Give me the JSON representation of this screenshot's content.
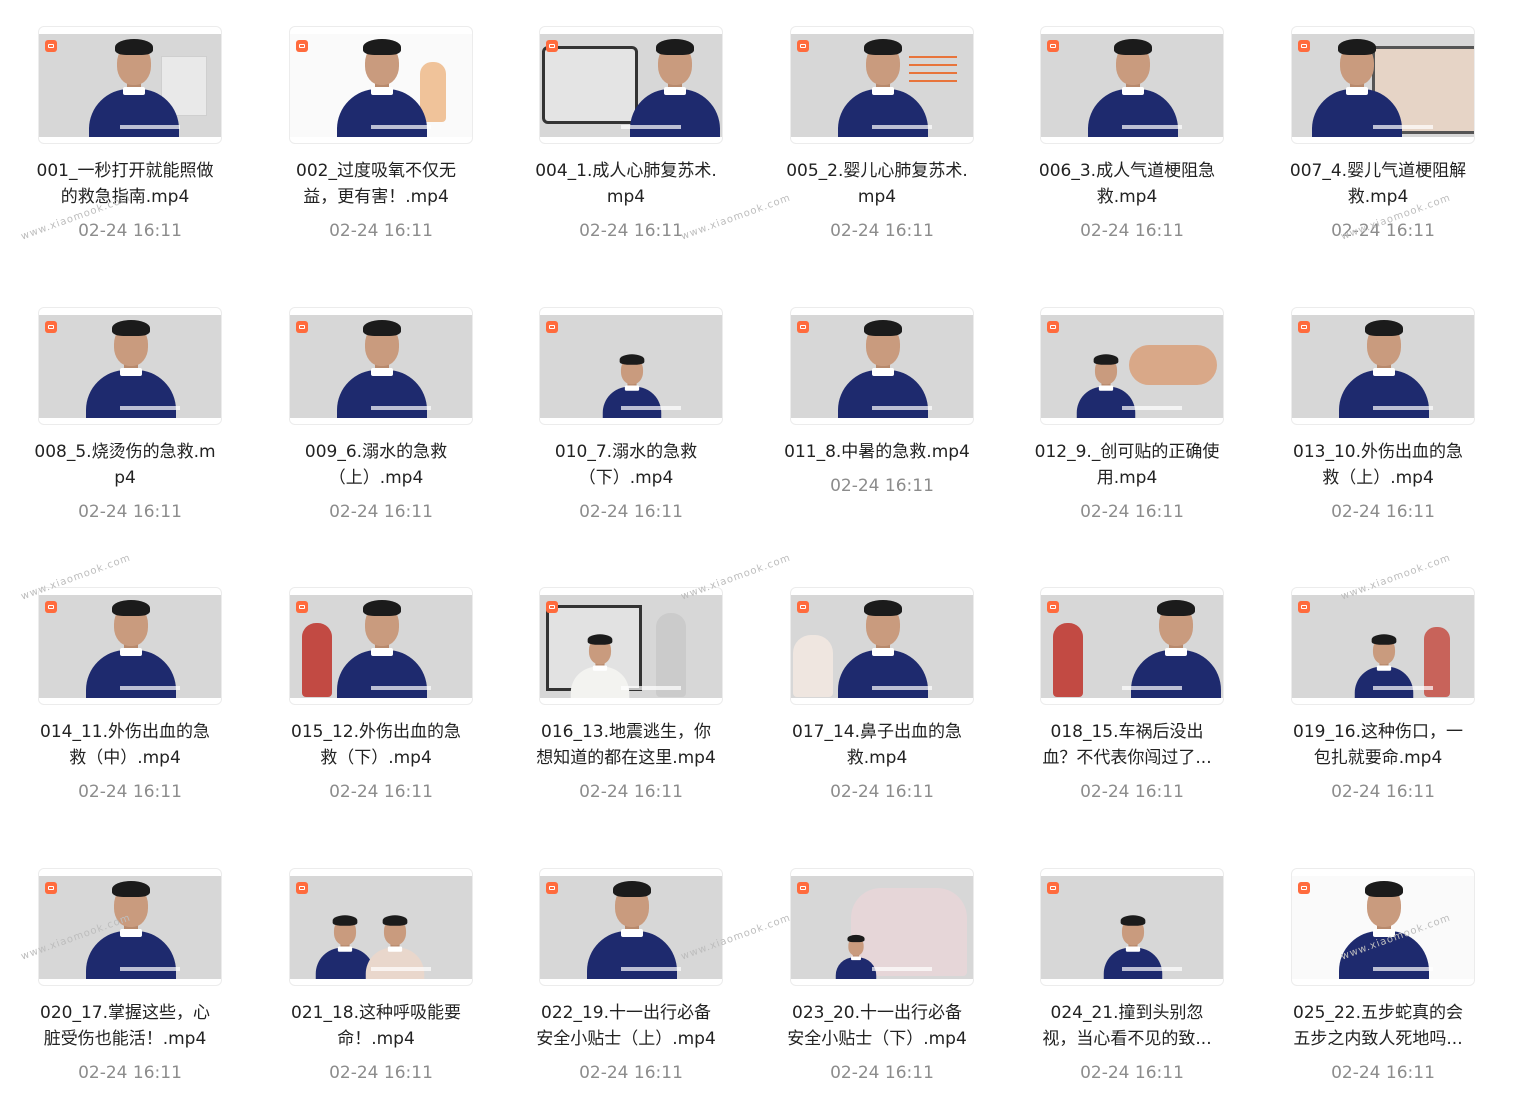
{
  "files": [
    {
      "title": "001_一秒打开就能照做\n的救急指南.mp4",
      "date": "02-24 16:11"
    },
    {
      "title": "002_过度吸氧不仅无\n益，更有害！.mp4",
      "date": "02-24 16:11"
    },
    {
      "title": "004_1.成人心肺复苏术.\nmp4",
      "date": "02-24 16:11"
    },
    {
      "title": "005_2.婴儿心肺复苏术.\nmp4",
      "date": "02-24 16:11"
    },
    {
      "title": "006_3.成人气道梗阻急\n救.mp4",
      "date": "02-24 16:11"
    },
    {
      "title": "007_4.婴儿气道梗阻解\n救.mp4",
      "date": "02-24 16:11"
    },
    {
      "title": "008_5.烧烫伤的急救.m\np4",
      "date": "02-24 16:11"
    },
    {
      "title": "009_6.溺水的急救\n（上）.mp4",
      "date": "02-24 16:11"
    },
    {
      "title": "010_7.溺水的急救\n（下）.mp4",
      "date": "02-24 16:11"
    },
    {
      "title": "011_8.中暑的急救.mp4",
      "date": "02-24 16:11"
    },
    {
      "title": "012_9._创可贴的正确使\n用.mp4",
      "date": "02-24 16:11"
    },
    {
      "title": "013_10.外伤出血的急\n救（上）.mp4",
      "date": "02-24 16:11"
    },
    {
      "title": "014_11.外伤出血的急\n救（中）.mp4",
      "date": "02-24 16:11"
    },
    {
      "title": "015_12.外伤出血的急\n救（下）.mp4",
      "date": "02-24 16:11"
    },
    {
      "title": "016_13.地震逃生，你\n想知道的都在这里.mp4",
      "date": "02-24 16:11"
    },
    {
      "title": "017_14.鼻子出血的急\n救.mp4",
      "date": "02-24 16:11"
    },
    {
      "title": "018_15.车祸后没出\n血？不代表你闯过了...",
      "date": "02-24 16:11"
    },
    {
      "title": "019_16.这种伤口，一\n包扎就要命.mp4",
      "date": "02-24 16:11"
    },
    {
      "title": "020_17.掌握这些，心\n脏受伤也能活！.mp4",
      "date": "02-24 16:11"
    },
    {
      "title": "021_18.这种呼吸能要\n命！.mp4",
      "date": "02-24 16:11"
    },
    {
      "title": "022_19.十一出行必备\n安全小贴士（上）.mp4",
      "date": "02-24 16:11"
    },
    {
      "title": "023_20.十一出行必备\n安全小贴士（下）.mp4",
      "date": "02-24 16:11"
    },
    {
      "title": "024_21.撞到头别忽\n视，当心看不见的致...",
      "date": "02-24 16:11"
    },
    {
      "title": "025_22.五步蛇真的会\n五步之内致人死地吗...",
      "date": "02-24 16:11"
    }
  ],
  "watermark_text": "www.xiaomook.com",
  "colors": {
    "badge": "#ff6b3d",
    "shirt": "#1e2a6e",
    "thumb_bg": "#d7d7d7",
    "title": "#222222",
    "date": "#8c8c8c"
  },
  "icons": {
    "badge": "video-file-icon"
  }
}
